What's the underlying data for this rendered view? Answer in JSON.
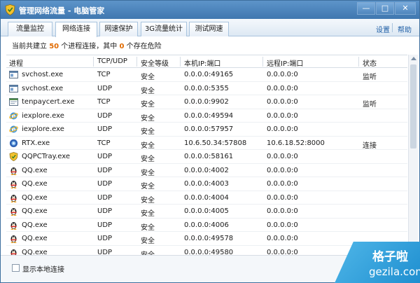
{
  "titlebar": {
    "title": "管理网络流量 - 电脑管家",
    "min": "—",
    "max": "□",
    "close": "✕"
  },
  "tabs": [
    {
      "label": "流量监控",
      "active": false
    },
    {
      "label": "网络连接",
      "active": true
    },
    {
      "label": "网速保护",
      "active": false
    },
    {
      "label": "3G流量统计",
      "active": false
    },
    {
      "label": "测试网速",
      "active": false
    }
  ],
  "toplinks": {
    "settings": "设置",
    "help": "帮助"
  },
  "summary": {
    "prefix": "当前共建立 ",
    "count": "50",
    "middle": " 个进程连接，其中 ",
    "danger": "0",
    "suffix": " 个存在危险"
  },
  "columns": {
    "process": "进程",
    "protocol": "TCP/UDP",
    "security": "安全等级",
    "local": "本机IP:端口",
    "remote": "远程IP:端口",
    "status": "状态"
  },
  "rows": [
    {
      "icon": "svchost-icon",
      "process": "svchost.exe",
      "protocol": "TCP",
      "security": "安全",
      "local": "0.0.0.0:49165",
      "remote": "0.0.0.0:0",
      "status": "监听"
    },
    {
      "icon": "svchost-icon",
      "process": "svchost.exe",
      "protocol": "UDP",
      "security": "安全",
      "local": "0.0.0.0:5355",
      "remote": "0.0.0.0:0",
      "status": ""
    },
    {
      "icon": "tenpaycert-icon",
      "process": "tenpaycert.exe",
      "protocol": "TCP",
      "security": "安全",
      "local": "0.0.0.0:9902",
      "remote": "0.0.0.0:0",
      "status": "监听"
    },
    {
      "icon": "ie-icon",
      "process": "iexplore.exe",
      "protocol": "UDP",
      "security": "安全",
      "local": "0.0.0.0:49594",
      "remote": "0.0.0.0:0",
      "status": ""
    },
    {
      "icon": "ie-icon",
      "process": "iexplore.exe",
      "protocol": "UDP",
      "security": "安全",
      "local": "0.0.0.0:57957",
      "remote": "0.0.0.0:0",
      "status": ""
    },
    {
      "icon": "rtx-icon",
      "process": "RTX.exe",
      "protocol": "TCP",
      "security": "安全",
      "local": "10.6.50.34:57808",
      "remote": "10.6.18.52:8000",
      "status": "连接"
    },
    {
      "icon": "qqpc-shield-icon",
      "process": "QQPCTray.exe",
      "protocol": "UDP",
      "security": "安全",
      "local": "0.0.0.0:58161",
      "remote": "0.0.0.0:0",
      "status": ""
    },
    {
      "icon": "qq-penguin-icon",
      "process": "QQ.exe",
      "protocol": "UDP",
      "security": "安全",
      "local": "0.0.0.0:4002",
      "remote": "0.0.0.0:0",
      "status": ""
    },
    {
      "icon": "qq-penguin-icon",
      "process": "QQ.exe",
      "protocol": "UDP",
      "security": "安全",
      "local": "0.0.0.0:4003",
      "remote": "0.0.0.0:0",
      "status": ""
    },
    {
      "icon": "qq-penguin-icon",
      "process": "QQ.exe",
      "protocol": "UDP",
      "security": "安全",
      "local": "0.0.0.0:4004",
      "remote": "0.0.0.0:0",
      "status": ""
    },
    {
      "icon": "qq-penguin-icon",
      "process": "QQ.exe",
      "protocol": "UDP",
      "security": "安全",
      "local": "0.0.0.0:4005",
      "remote": "0.0.0.0:0",
      "status": ""
    },
    {
      "icon": "qq-penguin-icon",
      "process": "QQ.exe",
      "protocol": "UDP",
      "security": "安全",
      "local": "0.0.0.0:4006",
      "remote": "0.0.0.0:0",
      "status": ""
    },
    {
      "icon": "qq-penguin-icon",
      "process": "QQ.exe",
      "protocol": "UDP",
      "security": "安全",
      "local": "0.0.0.0:49578",
      "remote": "0.0.0.0:0",
      "status": ""
    },
    {
      "icon": "qq-penguin-icon",
      "process": "QQ.exe",
      "protocol": "UDP",
      "security": "安全",
      "local": "0.0.0.0:49580",
      "remote": "0.0.0.0:0",
      "status": ""
    }
  ],
  "footer": {
    "checkbox_label": "显示本地连接",
    "checked": false
  },
  "watermark": {
    "main": "格子啦",
    "sub": "gezila.com"
  },
  "colors": {
    "titlebar": "#4a84bd",
    "link": "#1f5fa6",
    "count_highlight": "#e06a00",
    "watermark": "#2a9bd8"
  }
}
